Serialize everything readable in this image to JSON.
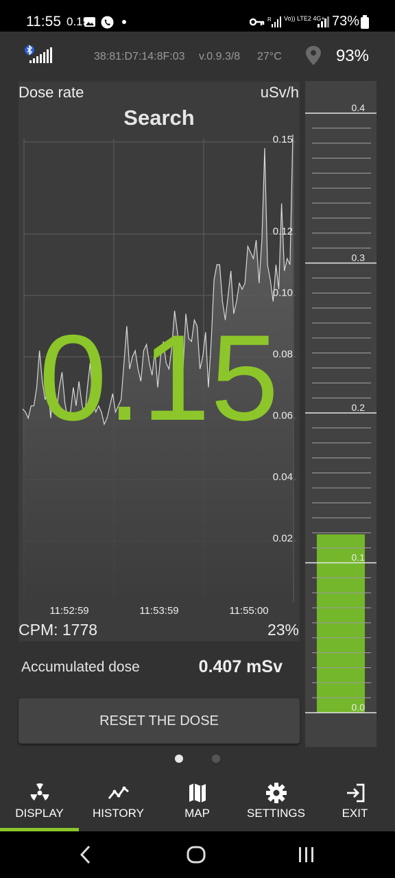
{
  "status_bar": {
    "time": "11:55",
    "time_small": "0.15",
    "signal_text": "Vo)) LTE2 4G+",
    "battery": "73%"
  },
  "device_info": {
    "mac": "38:81:D7:14:8F:03",
    "version": "v.0.9.3/8",
    "temperature": "27°C",
    "battery": "93%"
  },
  "dose_panel": {
    "title": "Dose rate",
    "unit": "uSv/h",
    "mode": "Search",
    "value": "0.15",
    "cpm": "CPM: 1778",
    "cpm_percent": "23%"
  },
  "chart_data": {
    "type": "area",
    "ylim": [
      0,
      0.15
    ],
    "y_ticks": [
      "0.15",
      "0.12",
      "0.10",
      "0.08",
      "0.06",
      "0.04",
      "0.02"
    ],
    "x_ticks": [
      "11:52:59",
      "11:53:59",
      "11:55:00"
    ],
    "values": [
      0.063,
      0.062,
      0.06,
      0.064,
      0.064,
      0.07,
      0.082,
      0.072,
      0.066,
      0.07,
      0.06,
      0.074,
      0.062,
      0.07,
      0.075,
      0.065,
      0.06,
      0.062,
      0.07,
      0.064,
      0.072,
      0.065,
      0.06,
      0.07,
      0.078,
      0.066,
      0.062,
      0.064,
      0.062,
      0.058,
      0.06,
      0.064,
      0.068,
      0.062,
      0.064,
      0.066,
      0.078,
      0.09,
      0.076,
      0.08,
      0.082,
      0.076,
      0.072,
      0.082,
      0.084,
      0.078,
      0.074,
      0.082,
      0.07,
      0.08,
      0.085,
      0.078,
      0.076,
      0.083,
      0.095,
      0.088,
      0.08,
      0.076,
      0.094,
      0.086,
      0.085,
      0.092,
      0.09,
      0.076,
      0.08,
      0.088,
      0.07,
      0.085,
      0.105,
      0.11,
      0.11,
      0.098,
      0.092,
      0.1,
      0.108,
      0.094,
      0.098,
      0.104,
      0.102,
      0.104,
      0.116,
      0.114,
      0.112,
      0.118,
      0.104,
      0.118,
      0.148,
      0.11,
      0.105,
      0.098,
      0.11,
      0.102,
      0.13,
      0.108,
      0.112,
      0.11,
      0.16
    ]
  },
  "scale": {
    "labels": [
      "0.4",
      "0.3",
      "0.2",
      "0.1",
      "0.0"
    ],
    "max": 0.4,
    "level": 0.119,
    "fill_color": "#74b72a"
  },
  "accumulated": {
    "label": "Accumulated dose",
    "value": "0.407 mSv"
  },
  "reset_button": {
    "label": "RESET THE DOSE"
  },
  "pager": {
    "pages": 2,
    "active": 0
  },
  "nav": [
    {
      "label": "DISPLAY",
      "icon": "radiation-icon",
      "active": true
    },
    {
      "label": "HISTORY",
      "icon": "chart-line-icon",
      "active": false
    },
    {
      "label": "MAP",
      "icon": "map-icon",
      "active": false
    },
    {
      "label": "SETTINGS",
      "icon": "gear-icon",
      "active": false
    },
    {
      "label": "EXIT",
      "icon": "exit-icon",
      "active": false
    }
  ],
  "colors": {
    "accent": "#8cc62a",
    "background": "#323232",
    "panel": "#3c3c3c"
  }
}
